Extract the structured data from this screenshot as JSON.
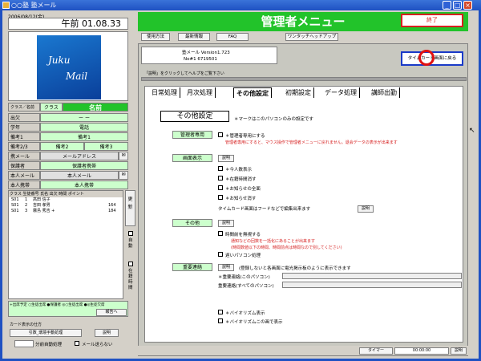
{
  "window": {
    "title": "○○塾 塾メール"
  },
  "left": {
    "date": "2006/08/12(金)",
    "clock": "午前 01.08.33",
    "logo_line1": "Juku",
    "logo_line2": "Mail",
    "class_label": "クラス／名前",
    "class_value": "クラス",
    "name_value": "名前",
    "rows": [
      {
        "label": "出欠",
        "value": "ー ー"
      },
      {
        "label": "学年",
        "value": "電話"
      },
      {
        "label": "備考1",
        "value": "備考1"
      },
      {
        "label": "備考2/3",
        "value": "備考2",
        "value2": "備考3"
      },
      {
        "label": "携メール",
        "value": "メールアドレス"
      },
      {
        "label": "保護者",
        "value": "保護者携帯"
      },
      {
        "label": "本人メール",
        "value": "本人メール"
      },
      {
        "label": "本人携帯",
        "value": "本人携帯"
      }
    ],
    "list_header": "クラス 生徒番号 氏名  出欠 時間  ポイント",
    "list_rows": [
      {
        "cls": "S01",
        "no": "1",
        "name": "高田 信子",
        "pt": ""
      },
      {
        "cls": "S01",
        "no": "2",
        "name": "吉田 孝男",
        "pt": "164"
      },
      {
        "cls": "S01",
        "no": "3",
        "name": "霧島 秀吉 +",
        "pt": "184"
      }
    ],
    "side_labels": {
      "update": "更新",
      "auto": "自動",
      "attend": "在籍時間"
    },
    "legend": "+出席予定 ○生徒出席 ●保護者 ◎○生徒出席 ●◎生徒欠席",
    "print_btn": "報告へ",
    "card_title": "カード表示の仕方",
    "card_field": "引数_環境手動処理",
    "card_help": "説明",
    "minutes_label": "分前自動処理",
    "no_mail_label": "メール送らない"
  },
  "header": {
    "title": "管理者メニュー",
    "exit": "終了"
  },
  "menubar": [
    "使用方法",
    "最新情報",
    "FAQ",
    "ワンタッチヘッドアップ"
  ],
  "version": {
    "app": "塾メール Version1.723",
    "no": "No#1 6719501"
  },
  "back_to_timecard": "タイムカード画面に戻る",
  "help_hint": "「説明」をクリックしてヘルプをご覧下さい",
  "tabs": [
    "日常処理",
    "月次処理",
    "その他設定",
    "初期設定",
    "データ処理",
    "講師出勤"
  ],
  "content": {
    "heading": "その他設定",
    "heading_note": "＊マークはこのパソコンのみの設定です",
    "sections": {
      "admin": {
        "title": "管理者専用",
        "chk": "＊管理者専用にする",
        "note": "管理者専用にすると、マウス操作で管理者メニューに戻れません。退会データの表示が出来ます"
      },
      "display": {
        "title": "画面表示",
        "help": "説明",
        "items": [
          "＊今人数表示",
          "＊在籍時間消す",
          "＊お知らせの全面",
          "＊お知らせ消す"
        ],
        "timecard_label": "タイムカード画面はフードなどで編集出来ます",
        "timecard_help": "説明"
      },
      "other": {
        "title": "その他",
        "help": "説明",
        "chk1": "時間前を無視する",
        "note1": "通知などの回数を一括化にあることが出来ます",
        "note2": "(時間数値以下の時間、時間前点は時間なので別してください)",
        "chk2": "遅いパソコン処理"
      },
      "important": {
        "title": "重要連絡",
        "help": "説明",
        "desc": "(登録しないと各画面に電光掲示板のように表示できます",
        "row1": "＊重要連絡(このパソコン)",
        "row2": "重要連絡(すべてのパソコン)"
      },
      "bio1": "＊バイオリズム表示",
      "bio2": "＊バイオリズムこの画で表示"
    }
  },
  "status": {
    "timer_label": "タイマー",
    "timer_value": "00:00:00",
    "help": "説明"
  }
}
